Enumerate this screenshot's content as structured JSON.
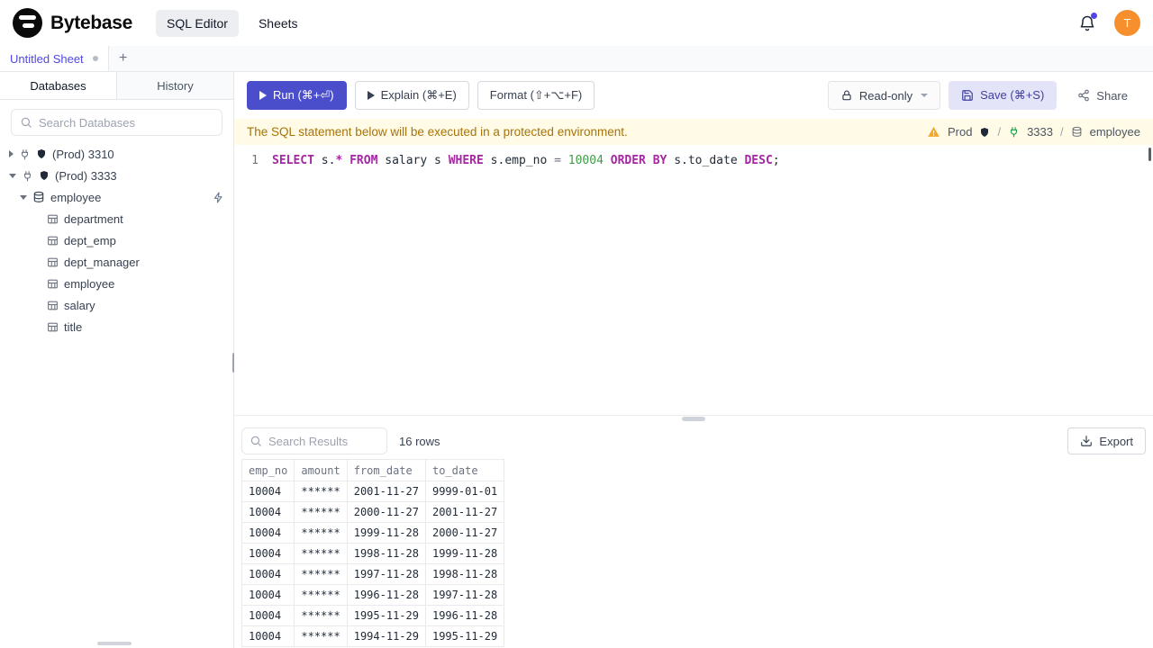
{
  "header": {
    "brand": "Bytebase",
    "nav_sql_editor": "SQL Editor",
    "nav_sheets": "Sheets",
    "avatar_letter": "T"
  },
  "sheetbar": {
    "tab": "Untitled Sheet",
    "add": "+"
  },
  "sidebar": {
    "tab_databases": "Databases",
    "tab_history": "History",
    "search_placeholder": "Search Databases",
    "tree": {
      "instance1": "(Prod) 3310",
      "instance2": "(Prod) 3333",
      "database": "employee",
      "tables": [
        "department",
        "dept_emp",
        "dept_manager",
        "employee",
        "salary",
        "title"
      ]
    }
  },
  "toolbar": {
    "run": "Run (⌘+⏎)",
    "explain": "Explain (⌘+E)",
    "format": "Format (⇧+⌥+F)",
    "readonly": "Read-only",
    "save": "Save (⌘+S)",
    "share": "Share"
  },
  "notice": {
    "message": "The SQL statement below will be executed in a protected environment.",
    "environment": "Prod",
    "separator": "/",
    "instance": "3333",
    "database": "employee"
  },
  "editor": {
    "line_number": "1",
    "tokens": [
      {
        "text": "SELECT",
        "type": "keyword"
      },
      {
        "text": " s.",
        "type": "plain"
      },
      {
        "text": "*",
        "type": "keyword"
      },
      {
        "text": " ",
        "type": "plain"
      },
      {
        "text": "FROM",
        "type": "keyword"
      },
      {
        "text": " salary s ",
        "type": "plain"
      },
      {
        "text": "WHERE",
        "type": "keyword"
      },
      {
        "text": " s.emp_no ",
        "type": "plain"
      },
      {
        "text": "=",
        "type": "operator"
      },
      {
        "text": " ",
        "type": "plain"
      },
      {
        "text": "10004",
        "type": "number"
      },
      {
        "text": " ",
        "type": "plain"
      },
      {
        "text": "ORDER BY",
        "type": "keyword"
      },
      {
        "text": " s.to_date ",
        "type": "plain"
      },
      {
        "text": "DESC",
        "type": "keyword"
      },
      {
        "text": ";",
        "type": "plain"
      }
    ]
  },
  "results": {
    "search_placeholder": "Search Results",
    "row_count": "16 rows",
    "export_label": "Export",
    "columns": [
      "emp_no",
      "amount",
      "from_date",
      "to_date"
    ],
    "rows": [
      [
        "10004",
        "******",
        "2001-11-27",
        "9999-01-01"
      ],
      [
        "10004",
        "******",
        "2000-11-27",
        "2001-11-27"
      ],
      [
        "10004",
        "******",
        "1999-11-28",
        "2000-11-27"
      ],
      [
        "10004",
        "******",
        "1998-11-28",
        "1999-11-28"
      ],
      [
        "10004",
        "******",
        "1997-11-28",
        "1998-11-28"
      ],
      [
        "10004",
        "******",
        "1996-11-28",
        "1997-11-28"
      ],
      [
        "10004",
        "******",
        "1995-11-29",
        "1996-11-28"
      ],
      [
        "10004",
        "******",
        "1994-11-29",
        "1995-11-29"
      ]
    ]
  },
  "colors": {
    "accent": "#4b4ecb",
    "warning_bg": "#fffbe6",
    "warning_text": "#a8730a",
    "keyword": "#a626a4",
    "number": "#3f9c47",
    "avatar_bg": "#f7902c",
    "env_warning_triangle": "#f5a623"
  }
}
